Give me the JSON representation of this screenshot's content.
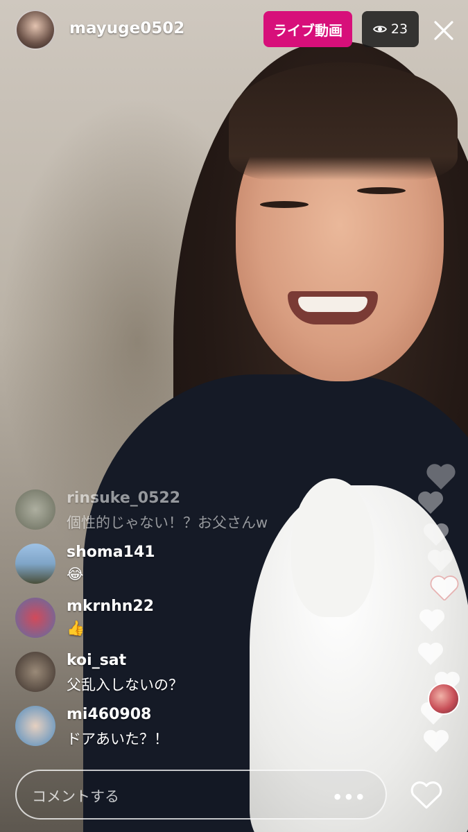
{
  "header": {
    "host_username": "mayuge0502",
    "live_label": "ライブ動画",
    "viewer_count": "23",
    "live_badge_color": "#d70f7a"
  },
  "comments": [
    {
      "username": "rinsuke_0522",
      "text": "個性的じゃない！？お父さんw"
    },
    {
      "username": "shoma141",
      "text": "😂"
    },
    {
      "username": "mkrnhn22",
      "text": "👍"
    },
    {
      "username": "koi_sat",
      "text": "父乱入しないの？"
    },
    {
      "username": "mi460908",
      "text": "ドアあいた？！"
    }
  ],
  "composer": {
    "placeholder": "コメントする",
    "more_label": "•••"
  },
  "icons": {
    "viewer": "eye-icon",
    "close": "close-icon",
    "like": "heart-icon",
    "more": "more-dots-icon"
  }
}
